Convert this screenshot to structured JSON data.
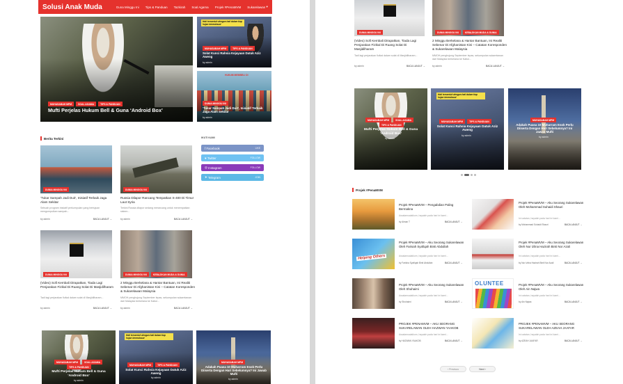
{
  "site": {
    "logo": "Solusi Anak Muda",
    "nav": [
      "Guna Minggu Ini",
      "Tips & Panduan",
      "Tazkirah",
      "Soal Agama",
      "Projek #PenaMVM",
      "Sukarelawan"
    ],
    "nav_more": "▾"
  },
  "featured": {
    "main": {
      "tags": [
        "MUHASABAH MPM",
        "SOAL AGAMA",
        "TIPS & PANDUAN"
      ],
      "title": "Mufti Perjelas Hukum Bell & Guna ‘Android Box’"
    },
    "side1": {
      "banner": "Hati tersentuh dengan hati dalam tiap hujan bermaksud",
      "tags": [
        "MUHASABAH MPM",
        "TIPS & PANDUAN"
      ],
      "title": "Solat Kunci Rahsia Kejayaan Datuk Aziz Aweng",
      "by": "by admin"
    },
    "side2": {
      "tags": [
        "DUNIA MINGGU INI"
      ],
      "title": "‘Tukar Sampah Jadi Duit’, Inisiatif Terbaik Jaga Alam Sekitar",
      "by": "by admin"
    }
  },
  "berita": {
    "heading": "Berita Terkini",
    "cards": [
      {
        "tag": "DUNIA MINGGU INI",
        "title": "‘Tukar Sampah Jadi Duit’, Inisiatif Terbaik Jaga Alam Sekitar",
        "ex": "Sebuah program inisiatif perkumpulan yang bertujuan mengumpulkan sampah...",
        "by": "by admin",
        "read": "BACA LANJUT →"
      },
      {
        "tag": "DUNIA MINGGU INI",
        "title": "Russia Dilapor Rancang Tempatkan S-400 Di Timur Laut Syria",
        "ex": "Terkini Russia dilapor sedang merancang untuk menempatkan sistem...",
        "by": "by admin",
        "read": "BACA LANJUT →"
      },
      {
        "tag": "DUNIA MINGGU INI",
        "title": "(Video) Sofi Kembali Dirapatkan, Tiada Lagi Penjarakan Fizikal Di Ruang Solat Di Masjidilharam",
        "ex": "Tadi lagi perjarakan fizikal dalam solat di Masjidilharam...",
        "by": "by admin",
        "read": "BACA LANJUT →"
      },
      {
        "tag": "DUNIA MINGGU INI",
        "tag2": "KEBAJIKAN MUDA & DUNIA",
        "title": "2 Minggu Berkelana & Hantar Bantuan, Ini Realiti Sebenar Di Afghanistan Kini – Catatan Koresponden & Sukarelawan Malaysia",
        "ex": "MMOH penghujung September lepas, sekumpulan sukarelawan dari Malaysia berkelana ke Kabul...",
        "by": "by admin",
        "read": "BACA LANJUT →"
      }
    ]
  },
  "social": {
    "heading": "IKUTI KAMI",
    "items": [
      {
        "name": "Facebook",
        "count": "LIKE",
        "color": "#3b5998"
      },
      {
        "name": "Twitter",
        "count": "FOLLOW",
        "color": "#1da1f2"
      },
      {
        "name": "Instagram",
        "count": "FOLLOW",
        "color": "#8a3ab9"
      },
      {
        "name": "Telegram",
        "count": "JOIN",
        "color": "#2ca5e0"
      }
    ]
  },
  "bottom_left": [
    {
      "tags": [
        "MUHASABAH MPM",
        "SOAL AGAMA",
        "TIPS & PANDUAN"
      ],
      "title": "Mufti Perjelas Hukum Bell & Guna ‘Android Box’",
      "by": "by admin"
    },
    {
      "banner": "Hati tersentuh dengan hati dalam tiap hujan bermaksud",
      "tags": [
        "MUHASABAH MPM",
        "TIPS & PANDUAN"
      ],
      "title": "Solat Kunci Rahsia Kejayaan Datuk Aziz Aweng",
      "by": "by admin"
    },
    {
      "tags": [
        "MUHASABAH MPM"
      ],
      "title": "Adakah Puasa 10 Muharram Esok Perlu Diiserta Dengan Hari Sebelumnya? Ini Jawab Mufti",
      "by": "by admin"
    }
  ],
  "right_top": [
    {
      "tag": "DUNIA MINGGU INI",
      "title": "(Video) Sofi Kembali Dirapatkan, Tiada Lagi Penjarakan Fizikal Di Ruang Solat Di Masjidilharam",
      "ex": "Tadi lagi perjarakan fizikal dalam solat di Masjidilharam...",
      "by": "by admin",
      "read": "BACA LANJUT →"
    },
    {
      "tag": "DUNIA MINGGU INI",
      "tag2": "KEBAJIKAN MUDA & DUNIA",
      "title": "2 Minggu Berkelana & Hantar Bantuan, Ini Realiti Sebenar Di Afghanistan Kini – Catatan Koresponden & Sukarelawan Malaysia",
      "ex": "MMOH penghujung September lepas, sekumpulan sukarelawan dari Malaysia berkelana ke Kabul...",
      "by": "by admin",
      "read": "BACA LANJUT →"
    }
  ],
  "slider": [
    {
      "tags": [
        "MUHASABAH MPM",
        "SOAL AGAMA",
        "TIPS & PANDUAN"
      ],
      "title": "Mufti Perjelas Hukum Bell & Guna ‘Android Box’",
      "by": "by admin"
    },
    {
      "banner": "Hati tersentuh dengan hati dalam tiap hujan bermaksud",
      "tags": [
        "MUHASABAH MPM",
        "TIPS & PANDUAN"
      ],
      "title": "Solat Kunci Rahsia Kejayaan Datuk Aziz Aweng",
      "by": "by admin"
    },
    {
      "tags": [
        "MUHASABAH MPM"
      ],
      "title": "Adakah Puasa 10 Muharram Esok Perlu Diiserta Dengan Hari Sebelumnya? Ini Jawab Mufti",
      "by": "by admin"
    }
  ],
  "projek": {
    "heading": "Projek #PenaMVM",
    "items": [
      {
        "title": "Projek #PenaMVM – Pengabdian Paling Bermakna",
        "ex": "Assalamualaikum, hayalah pada hari ini kami…",
        "by": "by Aiman T",
        "read": "BACA LANJUT →"
      },
      {
        "title": "Projek #PenaMVM – Aku Seorang Sukarelawan Oleh Mohammad Suhaidi Shauri",
        "ex": "Ini catatan, hayalah pada hari ini kami…",
        "by": "by Mohammad Suhaidi Shauri",
        "read": "BACA LANJUT →"
      },
      {
        "title": "Projek #PenaMVM – Aku Seorang Sukarelawan Oleh Farisah Syafiqah Binti Abdullah",
        "ex": "Assalamualaikum, hayalah pada hari ini kami…",
        "by": "by Farisha Syafiqah Binti Abdullah",
        "read": "BACA LANJUT →"
      },
      {
        "title": "Projek #PenaMVM – Aku Seorang Sukarelawan Oleh Nur Izlina Hazirah Binti Nor Azali",
        "ex": "Ini catatan, hayalah pada hari ini kami…",
        "by": "by Nur Izlina Hazirah Binti Nor Azali",
        "read": "BACA LANJUT →"
      },
      {
        "title": "Projek #PenaMVM – Aku Seorang Sukarelawan Oleh Shuhaimi",
        "ex": "Assalamualaikum, hayalah pada hari ini kami…",
        "by": "by Shuhaimi",
        "read": "BACA LANJUT →"
      },
      {
        "title": "Projek #PenaMVM – Aku Seorang Sukarelawan Oleh Ain Najwa",
        "ex": "Ini catatan, hayalah pada hari ini kami…",
        "by": "by Ain Najwa",
        "read": "BACA LANJUT →"
      },
      {
        "title": "PROJEK #PENAMVM – AKU SEORANG SUKARELAWAN OLEH HAZWAN YAAKOB",
        "ex": "Assalamualaikum, hayalah pada hari ini kami…",
        "by": "by HAZWAN YAAKOB",
        "read": "BACA LANJUT →"
      },
      {
        "title": "PROJEK #PENAMVM – AKU SEORANG SUKARELAWAN OLEH AZEAH JAAFAR",
        "ex": "Ini catatan, hayalah pada hari ini kami…",
        "by": "by AZEAH JAAFAR",
        "read": "BACA LANJUT →"
      }
    ],
    "thumb_texts": [
      "",
      "",
      "Helping Others",
      "",
      "",
      "OLUNTEE",
      "",
      ""
    ]
  },
  "pagination": {
    "prev": "‹ Previous",
    "next": "Next ›"
  }
}
